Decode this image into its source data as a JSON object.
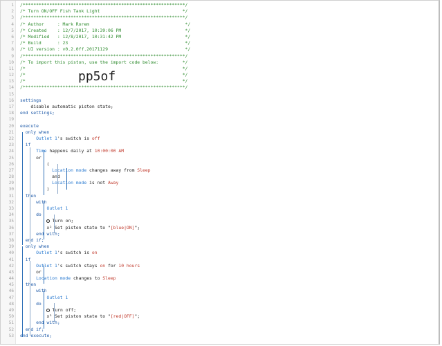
{
  "editor": {
    "code_lines": [
      {
        "n": "1",
        "tokens": [
          [
            "comment",
            "/*************************************************************/"
          ]
        ]
      },
      {
        "n": "2",
        "tokens": [
          [
            "comment",
            "/* Turn ON/OFF Fish Tank Light                               */"
          ]
        ]
      },
      {
        "n": "3",
        "tokens": [
          [
            "comment",
            "/*************************************************************/"
          ]
        ]
      },
      {
        "n": "4",
        "tokens": [
          [
            "comment",
            "/* Author     : Mark Rorem                                    */"
          ]
        ]
      },
      {
        "n": "5",
        "tokens": [
          [
            "comment",
            "/* Created    : 12/7/2017, 10:39:06 PM                        */"
          ]
        ]
      },
      {
        "n": "6",
        "tokens": [
          [
            "comment",
            "/* Modified   : 12/8/2017, 10:31:42 PM                        */"
          ]
        ]
      },
      {
        "n": "7",
        "tokens": [
          [
            "comment",
            "/* Build      : 23                                            */"
          ]
        ]
      },
      {
        "n": "8",
        "tokens": [
          [
            "comment",
            "/* UI version : v0.2.0ff.20171129                             */"
          ]
        ]
      },
      {
        "n": "9",
        "tokens": [
          [
            "comment",
            "/*************************************************************/"
          ]
        ]
      },
      {
        "n": "10",
        "tokens": [
          [
            "comment",
            "/* To import this piston, use the import code below:         */"
          ]
        ]
      },
      {
        "n": "11",
        "tokens": [
          [
            "comment",
            "/*                                                           */"
          ]
        ]
      },
      {
        "n": "12",
        "tokens": [
          [
            "comment",
            "/*                                                           */"
          ]
        ]
      },
      {
        "n": "13",
        "tokens": [
          [
            "comment",
            "/*                                                           */"
          ]
        ]
      },
      {
        "n": "14",
        "tokens": [
          [
            "comment",
            "/*************************************************************/"
          ]
        ]
      },
      {
        "n": "15",
        "tokens": []
      },
      {
        "n": "16",
        "tokens": [
          [
            "kw",
            "settings"
          ]
        ]
      },
      {
        "n": "17",
        "tokens": [
          [
            "plain",
            "    disable automatic piston state;"
          ]
        ]
      },
      {
        "n": "18",
        "tokens": [
          [
            "kw",
            "end settings;"
          ]
        ]
      },
      {
        "n": "19",
        "tokens": []
      },
      {
        "n": "20",
        "tokens": [
          [
            "kw",
            "execute"
          ]
        ]
      },
      {
        "n": "21",
        "tokens": [
          [
            "kw",
            "  only when"
          ]
        ]
      },
      {
        "n": "22",
        "tokens": [
          [
            "dev",
            "      Outlet 1"
          ],
          [
            "plain",
            "'s switch is "
          ],
          [
            "str",
            "off"
          ]
        ]
      },
      {
        "n": "23",
        "tokens": [
          [
            "kw",
            "  if"
          ]
        ]
      },
      {
        "n": "24",
        "tokens": [
          [
            "dev",
            "      Time"
          ],
          [
            "plain",
            " happens daily at "
          ],
          [
            "num",
            "10:00:00 AM"
          ]
        ]
      },
      {
        "n": "25",
        "tokens": [
          [
            "plain",
            "      or"
          ]
        ]
      },
      {
        "n": "26",
        "tokens": [
          [
            "plain",
            "          ("
          ]
        ]
      },
      {
        "n": "27",
        "tokens": [
          [
            "dev",
            "            Location mode"
          ],
          [
            "plain",
            " changes away from "
          ],
          [
            "str",
            "Sleep"
          ]
        ]
      },
      {
        "n": "28",
        "tokens": [
          [
            "plain",
            "            and"
          ]
        ]
      },
      {
        "n": "29",
        "tokens": [
          [
            "dev",
            "            Location mode"
          ],
          [
            "plain",
            " is not "
          ],
          [
            "str",
            "Away"
          ]
        ]
      },
      {
        "n": "30",
        "tokens": [
          [
            "plain",
            "          )"
          ]
        ]
      },
      {
        "n": "31",
        "tokens": [
          [
            "kw",
            "  then"
          ]
        ]
      },
      {
        "n": "32",
        "tokens": [
          [
            "kw",
            "      with"
          ]
        ]
      },
      {
        "n": "33",
        "tokens": [
          [
            "dev",
            "          Outlet 1"
          ]
        ]
      },
      {
        "n": "34",
        "tokens": [
          [
            "kw",
            "      do"
          ]
        ]
      },
      {
        "n": "35",
        "tokens": [
          [
            "icon",
            "power"
          ],
          [
            "plain",
            "Turn on;"
          ]
        ]
      },
      {
        "n": "36",
        "tokens": [
          [
            "plain",
            "          x² Set piston state to \""
          ],
          [
            "str",
            "[blue|ON]"
          ],
          [
            "plain",
            "\";"
          ]
        ]
      },
      {
        "n": "37",
        "tokens": [
          [
            "kw",
            "      end with;"
          ]
        ]
      },
      {
        "n": "38",
        "tokens": [
          [
            "kw",
            "  end if;"
          ]
        ]
      },
      {
        "n": "39",
        "tokens": [
          [
            "kw",
            "  only when"
          ]
        ]
      },
      {
        "n": "40",
        "tokens": [
          [
            "dev",
            "      Outlet 1"
          ],
          [
            "plain",
            "'s switch is "
          ],
          [
            "str",
            "on"
          ]
        ]
      },
      {
        "n": "41",
        "tokens": [
          [
            "kw",
            "  if"
          ]
        ]
      },
      {
        "n": "42",
        "tokens": [
          [
            "dev",
            "      Outlet 1"
          ],
          [
            "plain",
            "'s switch stays "
          ],
          [
            "str",
            "on"
          ],
          [
            "plain",
            " for "
          ],
          [
            "num",
            "10 hours"
          ]
        ]
      },
      {
        "n": "43",
        "tokens": [
          [
            "plain",
            "      or"
          ]
        ]
      },
      {
        "n": "44",
        "tokens": [
          [
            "dev",
            "      Location mode"
          ],
          [
            "plain",
            " changes to "
          ],
          [
            "str",
            "Sleep"
          ]
        ]
      },
      {
        "n": "45",
        "tokens": [
          [
            "kw",
            "  then"
          ]
        ]
      },
      {
        "n": "46",
        "tokens": [
          [
            "kw",
            "      with"
          ]
        ]
      },
      {
        "n": "47",
        "tokens": [
          [
            "dev",
            "          Outlet 1"
          ]
        ]
      },
      {
        "n": "48",
        "tokens": [
          [
            "kw",
            "      do"
          ]
        ]
      },
      {
        "n": "49",
        "tokens": [
          [
            "icon",
            "power"
          ],
          [
            "plain",
            "Turn off;"
          ]
        ]
      },
      {
        "n": "50",
        "tokens": [
          [
            "plain",
            "          x² Set piston state to \""
          ],
          [
            "str",
            "[red|OFF]"
          ],
          [
            "plain",
            "\";"
          ]
        ]
      },
      {
        "n": "51",
        "tokens": [
          [
            "kw",
            "      end with;"
          ]
        ]
      },
      {
        "n": "52",
        "tokens": [
          [
            "kw",
            "  end if;"
          ]
        ]
      },
      {
        "n": "53",
        "tokens": [
          [
            "kw",
            "end execute;"
          ]
        ]
      }
    ],
    "import_code": "pp5of"
  }
}
